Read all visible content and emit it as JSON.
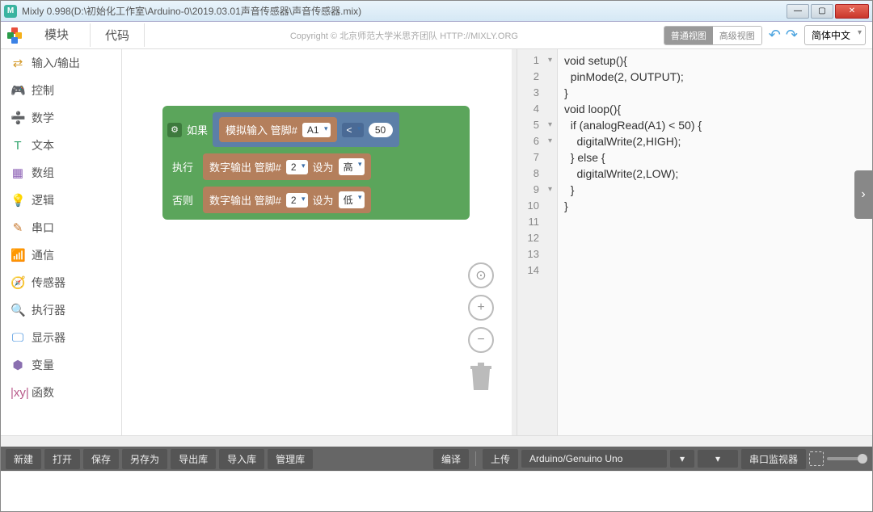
{
  "title": "Mixly 0.998(D:\\初始化工作室\\Arduino-0\\2019.03.01声音传感器\\声音传感器.mix)",
  "tabs": {
    "blocks": "模块",
    "code": "代码"
  },
  "copyright": "Copyright © 北京师范大学米思齐团队 HTTP://MIXLY.ORG",
  "view": {
    "normal": "普通视图",
    "advanced": "高级视图"
  },
  "lang": "简体中文",
  "sidebar": {
    "items": [
      {
        "icon": "⇄",
        "color": "#d49a2a",
        "label": "输入/输出"
      },
      {
        "icon": "🎮",
        "color": "#5ba55b",
        "label": "控制"
      },
      {
        "icon": "➗",
        "color": "#3b5fae",
        "label": "数学"
      },
      {
        "icon": "T",
        "color": "#2fa36b",
        "label": "文本"
      },
      {
        "icon": "▦",
        "color": "#8b5fb4",
        "label": "数组"
      },
      {
        "icon": "💡",
        "color": "#3b8bdc",
        "label": "逻辑"
      },
      {
        "icon": "✎",
        "color": "#c7772b",
        "label": "串口"
      },
      {
        "icon": "📶",
        "color": "#2fa389",
        "label": "通信"
      },
      {
        "icon": "🧭",
        "color": "#6a8f3a",
        "label": "传感器"
      },
      {
        "icon": "🔍",
        "color": "#5aa34a",
        "label": "执行器"
      },
      {
        "icon": "🖵",
        "color": "#3b8bdc",
        "label": "显示器"
      },
      {
        "icon": "⬢",
        "color": "#8a6fb0",
        "label": "变量"
      },
      {
        "icon": "|xy|",
        "color": "#b85a8a",
        "label": "函数"
      }
    ]
  },
  "blocks": {
    "if": "如果",
    "do": "执行",
    "else": "否则",
    "analogRead": "模拟输入 管脚#",
    "digitalWrite": "数字输出 管脚#",
    "setTo": "设为",
    "pinA1": "A1",
    "pin2": "2",
    "op": "<",
    "threshold": "50",
    "high": "高",
    "low": "低"
  },
  "code": {
    "lines": [
      "void setup(){",
      "  pinMode(2, OUTPUT);",
      "}",
      "",
      "void loop(){",
      "  if (analogRead(A1) < 50) {",
      "    digitalWrite(2,HIGH);",
      "",
      "  } else {",
      "    digitalWrite(2,LOW);",
      "",
      "  }",
      "",
      "}"
    ]
  },
  "status": {
    "new": "新建",
    "open": "打开",
    "save": "保存",
    "saveas": "另存为",
    "exportlib": "导出库",
    "importlib": "导入库",
    "managelib": "管理库",
    "compile": "编译",
    "upload": "上传",
    "board": "Arduino/Genuino Uno",
    "port": "",
    "serialmon": "串口监视器"
  }
}
